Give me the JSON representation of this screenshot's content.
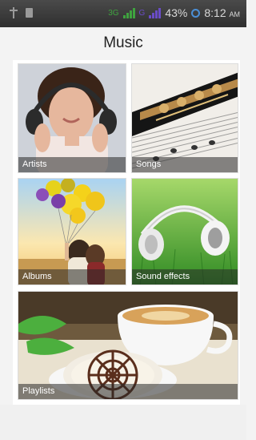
{
  "status_bar": {
    "network_label": "3G",
    "network_label2": "G",
    "battery": "43%",
    "time": "8:12",
    "time_suffix": "AM"
  },
  "header": {
    "title": "Music"
  },
  "tiles": {
    "artists": {
      "label": "Artists"
    },
    "songs": {
      "label": "Songs"
    },
    "albums": {
      "label": "Albums"
    },
    "sound_effects": {
      "label": "Sound effects"
    },
    "playlists": {
      "label": "Playlists"
    }
  },
  "colors": {
    "status_bar_bg": "#3a3a3a",
    "signal_green": "#3fa33f",
    "signal_purple": "#6a4cc7",
    "alarm_blue": "#4b8fd6"
  }
}
